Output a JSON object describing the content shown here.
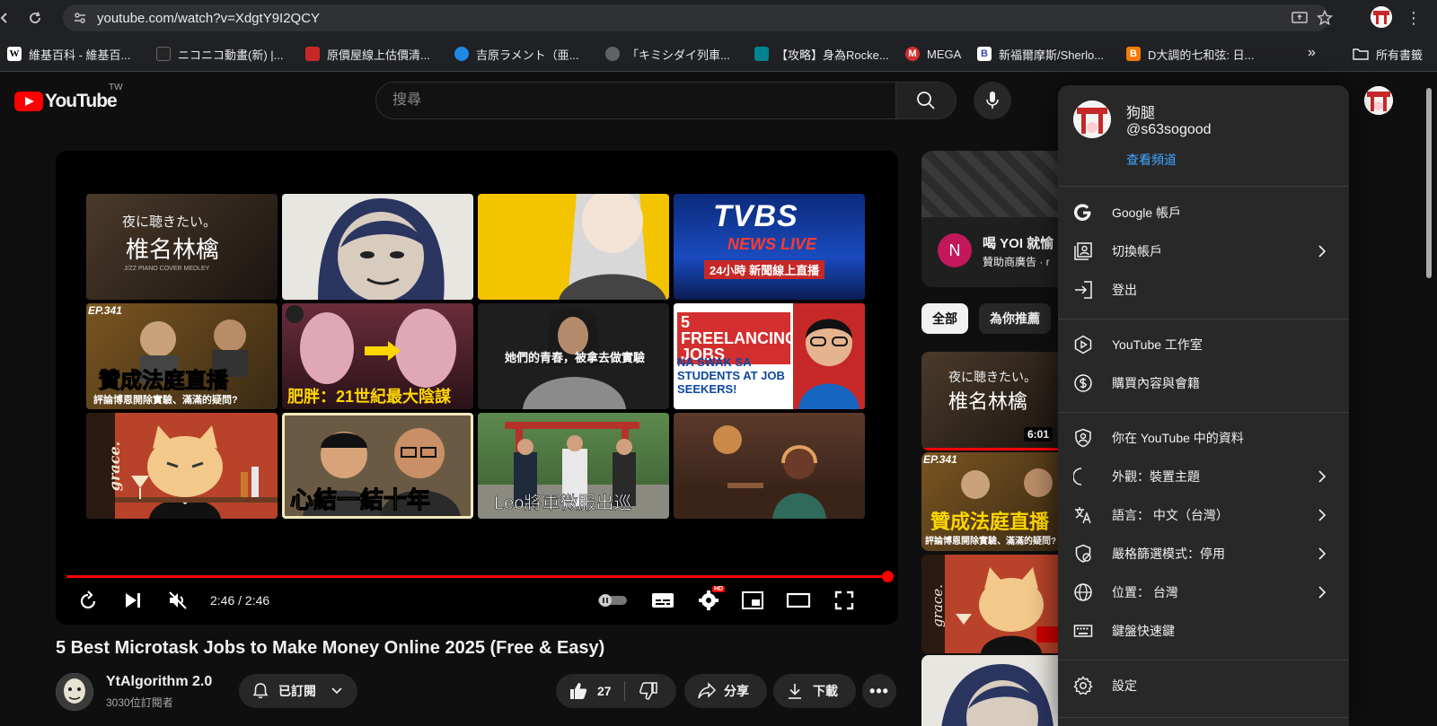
{
  "browser": {
    "url": "youtube.com/watch?v=XdgtY9I2QCY",
    "bookmarks": [
      {
        "label": "維基百科 - 維基百...",
        "icon": "W",
        "color": "#ffffff"
      },
      {
        "label": "ニコニコ動畫(新) |...",
        "icon": "niconico",
        "color": "#252525"
      },
      {
        "label": "原價屋線上估價清...",
        "icon": "coolpc",
        "color": "#c62828"
      },
      {
        "label": "吉原ラメント（亜...",
        "icon": "globe-blue",
        "color": "#1e88e5"
      },
      {
        "label": "「キミシダイ列車...",
        "icon": "globe",
        "color": "#5f6368"
      },
      {
        "label": "【攻略】身為Rocke...",
        "icon": "bahamut",
        "color": "#00838f"
      },
      {
        "label": "MEGA",
        "icon": "M",
        "color": "#d32f2f"
      },
      {
        "label": "新福爾摩斯/Sherlo...",
        "icon": "B",
        "color": "#ffffff"
      },
      {
        "label": "D大調的七和弦: 日...",
        "icon": "B",
        "color": "#f57c00"
      }
    ],
    "bookmarks_more": "»",
    "all_bookmarks": "所有書籤"
  },
  "header": {
    "logo_text": "YouTube",
    "region": "TW",
    "search_placeholder": "搜尋"
  },
  "player": {
    "time": "2:46 / 2:46",
    "progress": 1.0,
    "hd_badge": "HD",
    "endscreen": [
      {
        "name": "tile-piano-medley",
        "title": "椎名林檎",
        "subtitle": "夜に聴きたい。",
        "small": "J/ZZ PIANO COVER MEDLEY"
      },
      {
        "name": "tile-anime-face"
      },
      {
        "name": "tile-anime-yellow"
      },
      {
        "name": "tile-tvbs",
        "title": "TVBS",
        "subtitle": "NEWS LIVE",
        "small": "24小時 新聞線上直播"
      },
      {
        "name": "tile-live-court",
        "title": "贊成法庭直播",
        "badge": "EP.341",
        "small": "評論博恩開除實驗、滿滿的疑問?"
      },
      {
        "name": "tile-obesity",
        "title": "肥胖：21世紀最大陰謀"
      },
      {
        "name": "tile-youth",
        "title": "她們的青春，被拿去做實驗"
      },
      {
        "name": "tile-freelancing",
        "title": "5 FREELANCING JOBS",
        "subtitle": "NA SWAK SA STUDENTS AT JOB SEEKERS!"
      },
      {
        "name": "tile-grace-cat",
        "title": "grace."
      },
      {
        "name": "tile-ten-years",
        "title": "心結一結十年"
      },
      {
        "name": "tile-leo",
        "title": "Leo將軍微服出巡"
      },
      {
        "name": "tile-lofi"
      }
    ]
  },
  "video": {
    "title": "5 Best Microtask Jobs to Make Money Online 2025 (Free & Easy)",
    "channel": "YtAlgorithm 2.0",
    "subscribers": "3030位訂閱者",
    "subscribed_label": "已訂閱",
    "likes": "27",
    "share_label": "分享",
    "download_label": "下載"
  },
  "sidebar": {
    "ad_title": "喝 YOI 就愉",
    "ad_sub": "贊助商廣告 · r",
    "ad_logo": "N",
    "chips": [
      "全部",
      "為你推薦"
    ],
    "thumb_duration": "6:01"
  },
  "account_menu": {
    "name": "狗腿",
    "handle": "@s63sogood",
    "view_channel": "查看頻道",
    "items": [
      {
        "label": "Google 帳戶",
        "icon": "google-icon",
        "chevron": false
      },
      {
        "label": "切換帳戶",
        "icon": "switch-account-icon",
        "chevron": true
      },
      {
        "label": "登出",
        "icon": "sign-out-icon",
        "chevron": false
      },
      {
        "label": "YouTube 工作室",
        "icon": "studio-icon",
        "chevron": false
      },
      {
        "label": "購買內容與會籍",
        "icon": "dollar-icon",
        "chevron": false
      },
      {
        "label": "你在 YouTube 中的資料",
        "icon": "shield-person-icon",
        "chevron": false
      },
      {
        "label": "外觀：裝置主題",
        "icon": "moon-icon",
        "chevron": true
      },
      {
        "label": "語言： 中文（台灣）",
        "icon": "translate-icon",
        "chevron": true
      },
      {
        "label": "嚴格篩選模式：停用",
        "icon": "restricted-icon",
        "chevron": true
      },
      {
        "label": "位置： 台灣",
        "icon": "globe-icon",
        "chevron": true
      },
      {
        "label": "鍵盤快速鍵",
        "icon": "keyboard-icon",
        "chevron": false
      },
      {
        "label": "設定",
        "icon": "settings-icon",
        "chevron": false
      }
    ]
  }
}
